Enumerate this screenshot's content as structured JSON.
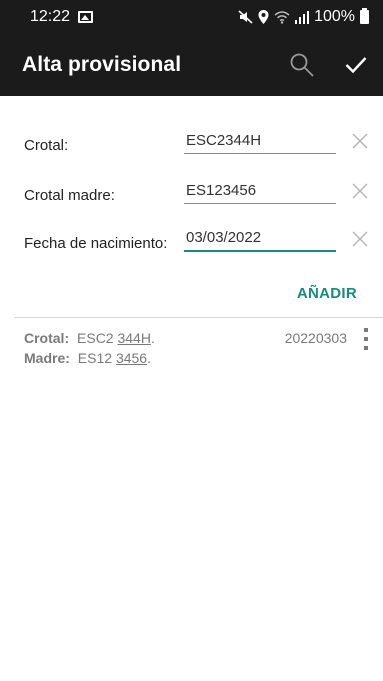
{
  "status_bar": {
    "time": "12:22",
    "battery": "100%"
  },
  "app_bar": {
    "title": "Alta provisional",
    "search_icon": "search-icon",
    "confirm_icon": "check-icon"
  },
  "form": {
    "fields": [
      {
        "label": "Crotal:",
        "value": "ESC2344H"
      },
      {
        "label": "Crotal madre:",
        "value": "ES123456"
      },
      {
        "label": "Fecha de nacimiento:",
        "value": "03/03/2022"
      }
    ],
    "add_label": "AÑADIR"
  },
  "list": {
    "items": [
      {
        "crotal_key": "Crotal:",
        "crotal_a": "ESC2",
        "crotal_b": "344H",
        "crotal_dot": ".",
        "madre_key": "Madre:",
        "madre_a": "ES12",
        "madre_b": "3456",
        "madre_dot": ".",
        "date": "20220303"
      }
    ]
  },
  "colors": {
    "accent": "#1a8a80",
    "bar_bg": "#1b1b1b"
  }
}
